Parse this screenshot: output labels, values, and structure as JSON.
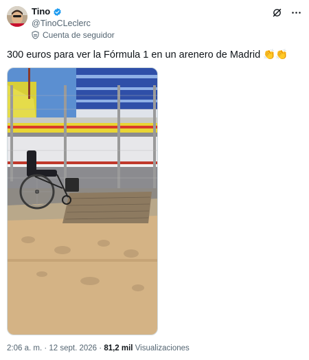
{
  "author": {
    "display_name": "Tino",
    "handle": "@TinoCLeclerc",
    "verified_icon": "verified-badge-icon",
    "follower_label": "Cuenta de seguidor"
  },
  "tweet": {
    "text": "300 euros para ver la Fórmula 1 en un arenero de Madrid 👏👏"
  },
  "meta": {
    "time": "2:06 a. m.",
    "sep1": " · ",
    "date": "12 sept. 2026",
    "sep2": " · ",
    "views_count": "81,2 mil",
    "views_label": " Visualizaciones"
  },
  "colors": {
    "verified": "#1d9bf0",
    "secondary_text": "#536471",
    "primary_text": "#0f1419"
  }
}
